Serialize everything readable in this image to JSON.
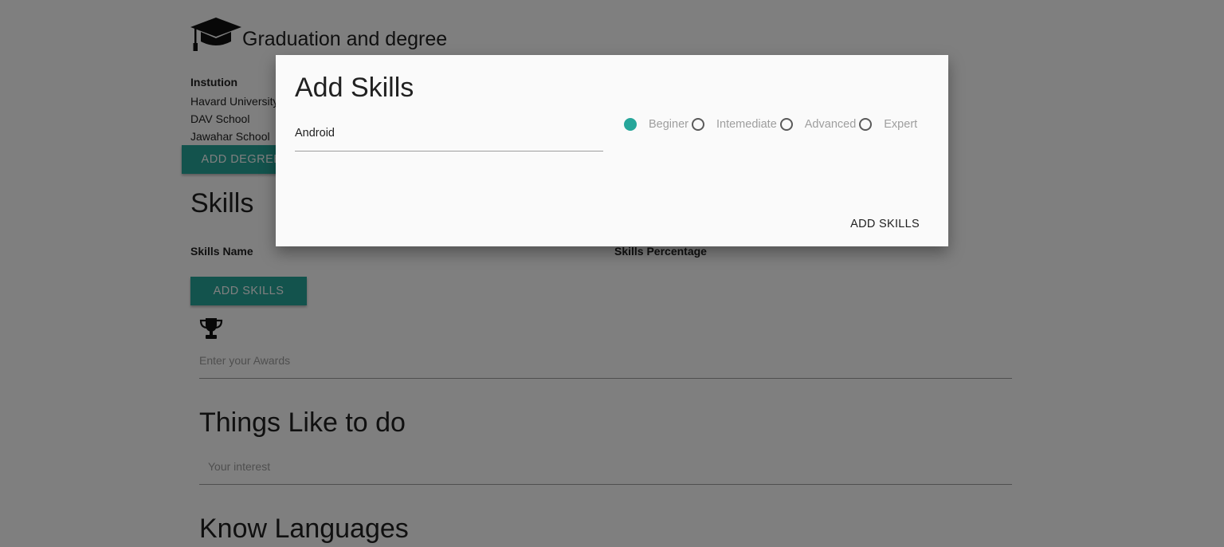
{
  "education": {
    "title": "Graduation and degree",
    "institution_label": "Instution",
    "institutions": [
      "Havard University",
      "DAV School",
      "Jawahar School"
    ],
    "add_button": "ADD DEGREE"
  },
  "skills": {
    "title": "Skills",
    "col_name": "Skills Name",
    "col_percentage": "Skills Percentage",
    "add_button": "ADD SKILLS"
  },
  "awards": {
    "placeholder": "Enter your Awards"
  },
  "interests": {
    "title": "Things Like to do",
    "placeholder": "Your interest"
  },
  "languages": {
    "title": "Know Languages"
  },
  "modal": {
    "title": "Add Skills",
    "skill_value": "Android",
    "levels": [
      {
        "label": "Beginer",
        "checked": true
      },
      {
        "label": "Intemediate",
        "checked": false
      },
      {
        "label": "Advanced",
        "checked": false
      },
      {
        "label": "Expert",
        "checked": false
      }
    ],
    "action": "ADD SKILLS"
  },
  "colors": {
    "accent": "#26a69a",
    "overlay": "rgba(0,0,0,0.5)"
  }
}
